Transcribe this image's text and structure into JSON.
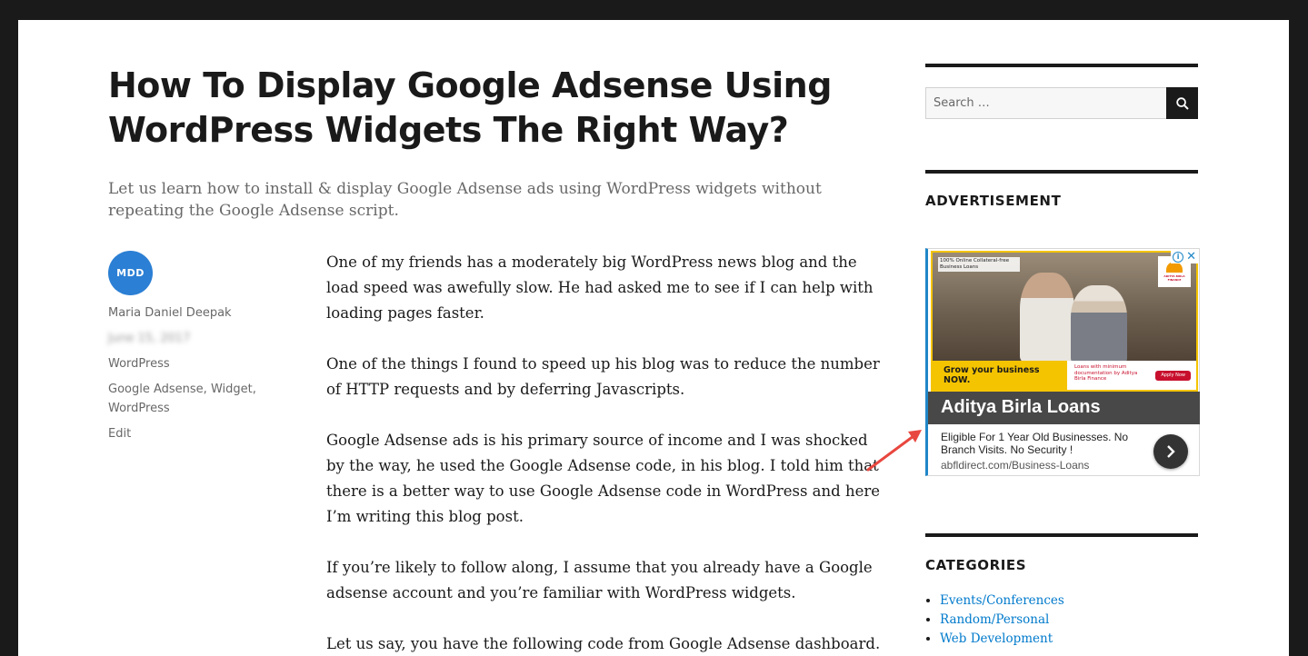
{
  "post": {
    "title": "How To Display Google Adsense Using WordPress Widgets The Right Way?",
    "excerpt": "Let us learn how to install & display Google Adsense ads using WordPress widgets without repeating the Google Adsense script."
  },
  "meta": {
    "avatar_initials": "MDD",
    "author": "Maria Daniel Deepak",
    "date": "June 15, 2017",
    "category": "WordPress",
    "tags": "Google Adsense, Widget, WordPress",
    "edit": "Edit"
  },
  "content": {
    "paragraphs": [
      "One of my friends has a moderately big WordPress news blog and the load speed was awefully slow. He had asked me to see if I can help with loading pages faster.",
      "One of the things I found to speed up his blog was to reduce the number of HTTP requests and by deferring Javascripts.",
      "Google Adsense ads is his primary source of income and I was shocked by the way, he used the Google Adsense code, in his blog. I told him that there is a better way to use Google Adsense code in WordPress and here I’m writing this blog post.",
      "If you’re likely to follow along, I assume that you already have a Google adsense account and you’re familiar with WordPress widgets.",
      "Let us say, you have the following code from Google Adsense dashboard."
    ]
  },
  "sidebar": {
    "search": {
      "placeholder": "Search …",
      "button_icon": "search-icon"
    },
    "advertisement_title": "ADVERTISEMENT",
    "ad": {
      "image_tagline": "100% Online Collateral-free Business Loans",
      "brand_logo": "ADITYA BIRLA FINANCE",
      "image_cta": "Grow your business NOW.",
      "image_small": "Loans with minimum documentation by Aditya Birla Finance",
      "image_apply": "Apply Now",
      "headline": "Aditya Birla Loans",
      "description": "Eligible For 1 Year Old Businesses. No Branch Visits. No Security !",
      "url": "abfldirect.com/Business-Loans"
    },
    "categories_title": "CATEGORIES",
    "categories": [
      "Events/Conferences",
      "Random/Personal",
      "Web Development"
    ]
  },
  "colors": {
    "accent_link": "#007acc",
    "annotation_arrow": "#e8473f",
    "ad_border": "#1f87c8",
    "ad_yellow": "#f5c400"
  }
}
